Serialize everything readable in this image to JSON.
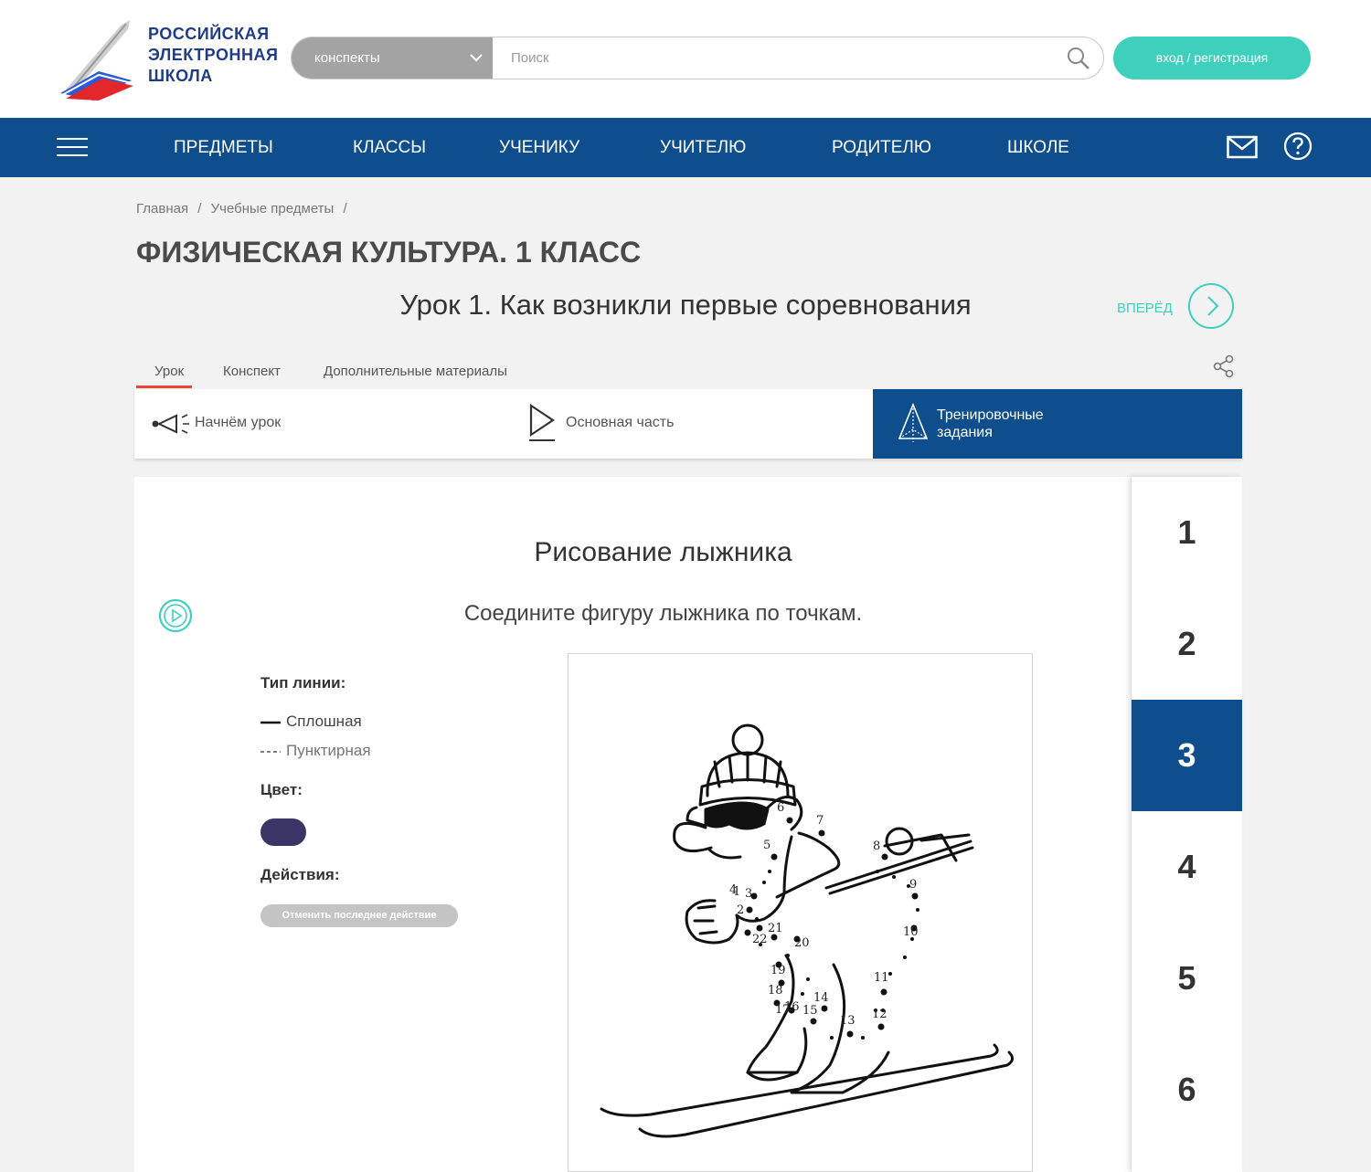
{
  "header": {
    "logo_lines": [
      "РОССИЙСКАЯ",
      "ЭЛЕКТРОННАЯ",
      "ШКОЛА"
    ],
    "search_category": "конспекты",
    "search_placeholder": "Поиск",
    "login_label": "вход / регистрация"
  },
  "nav": {
    "items": [
      "ПРЕДМЕТЫ",
      "КЛАССЫ",
      "УЧЕНИКУ",
      "УЧИТЕЛЮ",
      "РОДИТЕЛЮ",
      "ШКОЛЕ"
    ]
  },
  "breadcrumb": [
    "Главная",
    "/",
    "Учебные предметы",
    "/"
  ],
  "page_title": "ФИЗИЧЕСКАЯ КУЛЬТУРА. 1 КЛАСС",
  "lesson_title": "Урок 1. Как возникли первые соревнования",
  "forward_label": "ВПЕРЁД",
  "tabs": [
    "Урок",
    "Конспект",
    "Дополнительные материалы"
  ],
  "sections": [
    "Начнём урок",
    "Основная часть",
    "Тренировочные задания"
  ],
  "task": {
    "title": "Рисование лыжника",
    "subtitle": "Соедините фигуру лыжника по точкам.",
    "line_type_heading": "Тип линии:",
    "line_solid": "Сплошная",
    "line_dashed": "Пунктирная",
    "color_heading": "Цвет:",
    "selected_color": "#3a3566",
    "actions_heading": "Действия:",
    "undo_label": "Отменить последнее действие",
    "dot_numbers": [
      "1",
      "2",
      "3",
      "4",
      "5",
      "6",
      "7",
      "8",
      "9",
      "10",
      "11",
      "12",
      "13",
      "14",
      "15",
      "16",
      "17",
      "18",
      "19",
      "20",
      "21",
      "22"
    ]
  },
  "steps": [
    "1",
    "2",
    "3",
    "4",
    "5",
    "6"
  ],
  "active_step": "3",
  "colors": {
    "brand_blue": "#0e4e8c",
    "accent_teal": "#3ecfbd",
    "tab_underline": "#e5473a"
  }
}
